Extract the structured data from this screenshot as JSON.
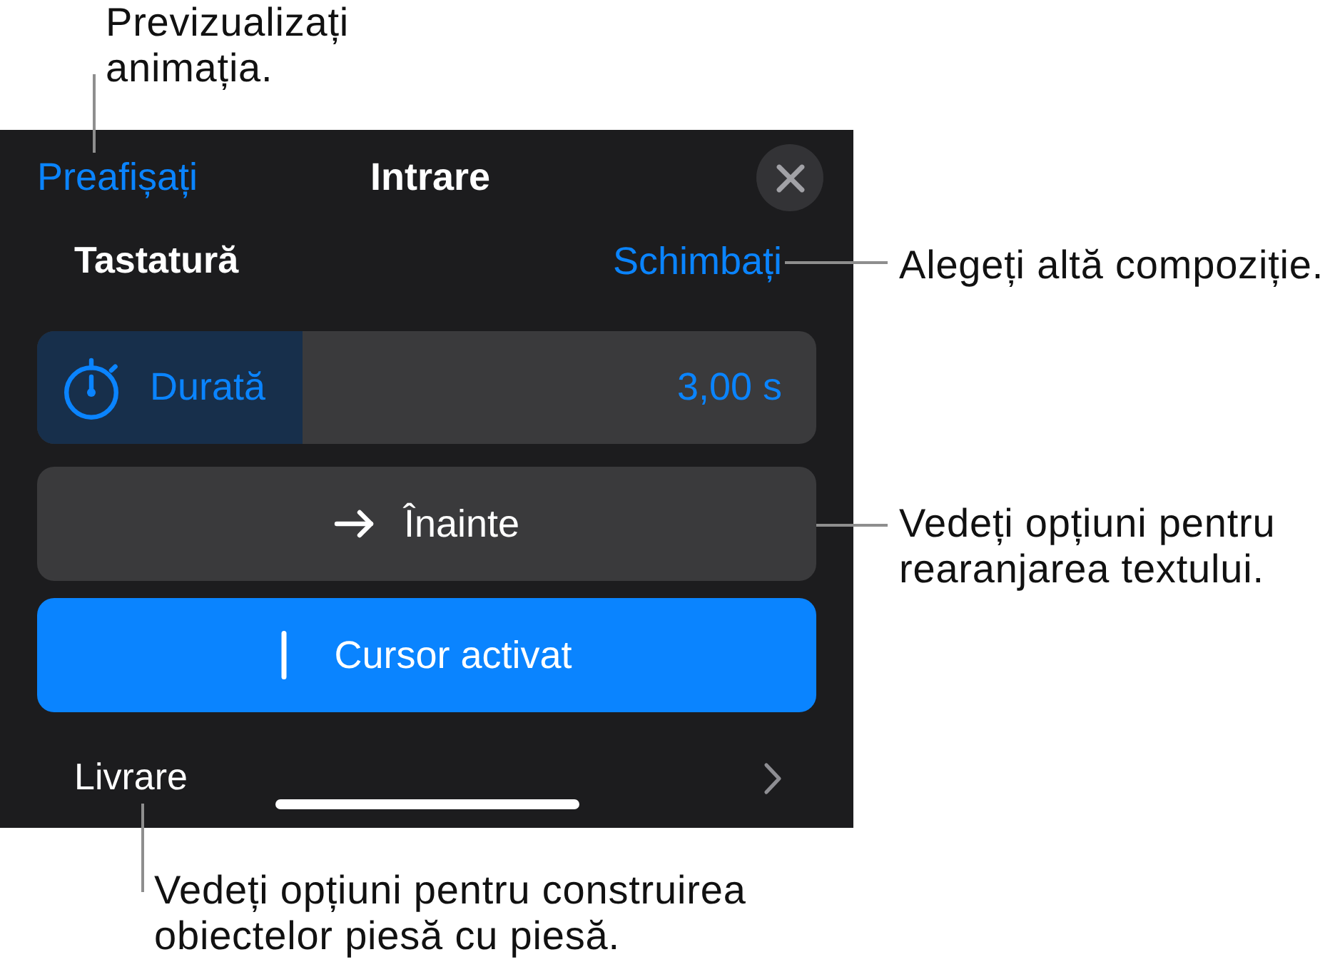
{
  "annotations": [
    {
      "text": "Previzualizați animația."
    },
    {
      "text": "Alegeți altă compoziție."
    },
    {
      "text": "Vedeți opțiuni pentru rearanjarea textului."
    },
    {
      "text": "Vedeți opțiuni pentru construirea obiectelor piesă cu piesă."
    }
  ],
  "panel": {
    "preview_button": "Preafișați",
    "title": "Intrare",
    "effect": {
      "name": "Tastatură",
      "change_button": "Schimbați"
    },
    "duration": {
      "label": "Durată",
      "value": "3,00 s",
      "level": 0.34
    },
    "direction_button": {
      "label": "Înainte"
    },
    "cursor_toggle": {
      "label": "Cursor activat",
      "on": true
    },
    "delivery_row": {
      "label": "Livrare"
    }
  }
}
